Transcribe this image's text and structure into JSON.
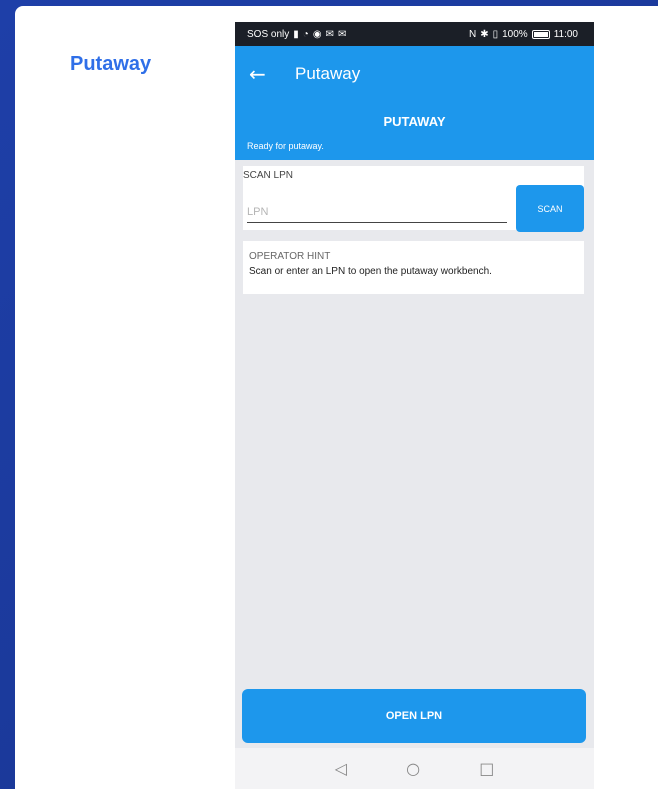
{
  "card": {
    "title": "Putaway"
  },
  "status_bar": {
    "left_text": "SOS only",
    "left_icons": [
      "sim-icon",
      "wifi-icon",
      "eye-icon",
      "mail-icon",
      "mail-icon"
    ],
    "right_icons": [
      "nfc-icon",
      "bluetooth-icon",
      "vibrate-icon"
    ],
    "battery_percent": "100%",
    "time": "11:00"
  },
  "app_bar": {
    "title": "Putaway",
    "back_icon": "arrow-left-icon"
  },
  "banner": {
    "title": "PUTAWAY",
    "subtitle": "Ready for putaway."
  },
  "scan": {
    "label": "SCAN LPN",
    "input_placeholder": "LPN",
    "input_value": "",
    "button_label": "SCAN"
  },
  "hint": {
    "title": "OPERATOR HINT",
    "text": "Scan or enter an LPN to open the putaway workbench."
  },
  "footer": {
    "open_button_label": "OPEN LPN"
  },
  "nav_bar": {
    "icons": [
      "back-triangle-icon",
      "home-circle-icon",
      "recents-square-icon"
    ]
  },
  "colors": {
    "accent": "#1d97ec",
    "title_blue": "#2f6fe8",
    "background": "#1a3a9e"
  }
}
